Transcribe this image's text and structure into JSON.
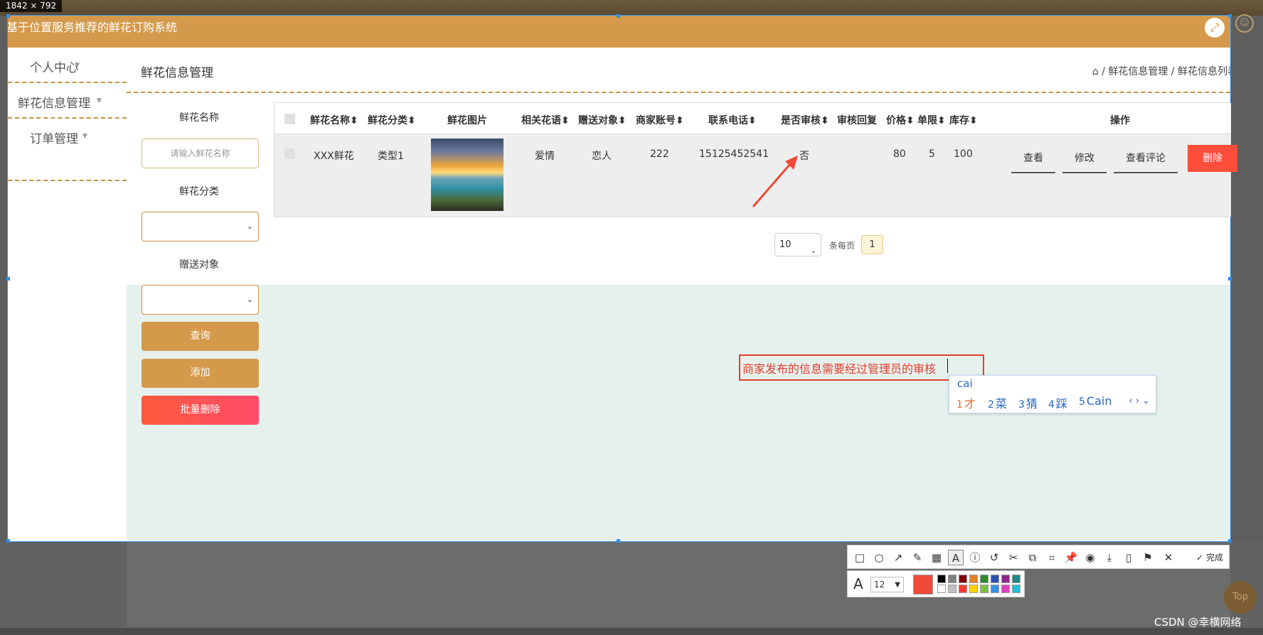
{
  "capture_size": "1842 × 792",
  "app": {
    "title": "基于位置服务推荐的鲜花订购系统",
    "expand_icon": "expand-icon"
  },
  "nav": {
    "items": [
      {
        "label": "个人中心"
      },
      {
        "label": "鲜花信息管理"
      },
      {
        "label": "订单管理"
      }
    ]
  },
  "page": {
    "title": "鲜花信息管理",
    "breadcrumb": [
      "鲜花信息管理",
      "鲜花信息列表"
    ]
  },
  "search": {
    "name_label": "鲜花名称",
    "name_placeholder": "请输入鲜花名称",
    "category_label": "鲜花分类",
    "target_label": "赠送对象",
    "query_button": "查询",
    "add_button": "添加",
    "batch_delete_button": "批量删除"
  },
  "table": {
    "headers": [
      "鲜花名称",
      "鲜花分类",
      "鲜花图片",
      "相关花语",
      "赠送对象",
      "商家账号",
      "联系电话",
      "是否审核",
      "审核回复",
      "价格",
      "单限",
      "库存",
      "操作"
    ],
    "rows": [
      {
        "name": "XXX鲜花",
        "category": "类型1",
        "language": "爱情",
        "target": "恋人",
        "merchant": "222",
        "phone": "15125452541",
        "audited": "否",
        "reply": "",
        "price": "80",
        "limit": "5",
        "stock": "100"
      }
    ],
    "actions": {
      "view": "查看",
      "edit": "修改",
      "comments": "查看评论",
      "delete": "删除"
    }
  },
  "pagination": {
    "page_size": "10",
    "per_page_label": "条每页",
    "current_page": "1"
  },
  "annotation": {
    "text": "商家发布的信息需要经过管理员的审核",
    "color": "#e33e2c"
  },
  "ime": {
    "composition": "cai",
    "candidates": [
      {
        "n": "1",
        "text": "才"
      },
      {
        "n": "2",
        "text": "菜"
      },
      {
        "n": "3",
        "text": "猜"
      },
      {
        "n": "4",
        "text": "踩"
      },
      {
        "n": "5",
        "text": "Cain"
      }
    ]
  },
  "toolbar": {
    "finish_label": "完成",
    "font_size": "12",
    "current_color": "#f14a36",
    "swatches": [
      "#000000",
      "#808080",
      "#800000",
      "#e0822a",
      "#2e8b2e",
      "#2a4fb0",
      "#8b2a8b",
      "#1a8a8a",
      "#ffffff",
      "#c0c0c0",
      "#ff3b30",
      "#ffd200",
      "#7ac142",
      "#3a8ee6",
      "#e040c0",
      "#20c0e0"
    ]
  },
  "top_button": "Top",
  "watermark": "CSDN @幸横网络",
  "colors": {
    "brand": "#d4994a",
    "danger": "#ff4f3c",
    "selection": "#2e8ef0"
  }
}
